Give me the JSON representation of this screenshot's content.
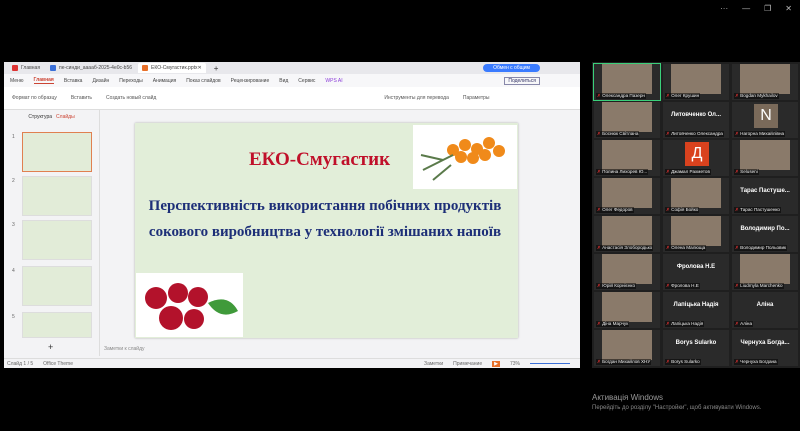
{
  "app": {
    "tabs": [
      {
        "label": "Главная",
        "color": "#d33"
      },
      {
        "label": "пе-синди_ааааб-2025-4e0c-b56",
        "color": "#3a6fd8"
      },
      {
        "label": "ЕКО-Смугастик.pptx",
        "color": "#e8702a"
      }
    ],
    "meet_button": "Обмен с общим",
    "share": "Поделиться"
  },
  "menu": {
    "items": [
      "Меню",
      "Главная",
      "Вставка",
      "Дизайн",
      "Переходы",
      "Анимация",
      "Показ слайдов",
      "Рецензирование",
      "Вид",
      "Сервис",
      "WPS AI"
    ],
    "active": "Главная"
  },
  "ribbon": {
    "items": [
      "Формат по образцу",
      "Вставить",
      "Создать новый слайд",
      "Инструменты для перевода",
      "Параметры"
    ]
  },
  "left_panel": {
    "tabs": [
      "Структура",
      "Слайды"
    ],
    "count": 5
  },
  "slide": {
    "title": "ЕКО-Смугастик",
    "subtitle": "Перспективність використання побічних продуктів сокового виробництва у технології змішаних напоїв"
  },
  "notes": "Заметки к слайду",
  "status": {
    "slide": "Слайд 1 / 5",
    "theme": "Office Theme",
    "notes_btn": "Заметки",
    "comments": "Примечание",
    "zoom": "73%"
  },
  "participants": [
    {
      "name": "Олександра Пазерн",
      "label": "",
      "avatar": "video"
    },
    {
      "name": "Олег Крушин",
      "label": "",
      "avatar": "video"
    },
    {
      "name": "Bogdan Mykhailov",
      "label": "",
      "avatar": "video"
    },
    {
      "name": "Боснюк Світлана",
      "label": "",
      "avatar": "video"
    },
    {
      "name": "Литовченко Олександра",
      "label": "Литовченко Ол...",
      "avatar": "none"
    },
    {
      "name": "Нагорна Михайлівна",
      "label": "",
      "avatar": "N"
    },
    {
      "name": "Полина Лихорев Ю...",
      "label": "",
      "avatar": "video"
    },
    {
      "name": "Джамал Рахметов",
      "label": "",
      "avatar": "Д"
    },
    {
      "name": "Seluseni",
      "label": "",
      "avatar": "video"
    },
    {
      "name": "Олег Федоров",
      "label": "",
      "avatar": "video"
    },
    {
      "name": "Софія Бойко",
      "label": "",
      "avatar": "video"
    },
    {
      "name": "Тарас Пастушенко",
      "label": "Тарас Пастуше...",
      "avatar": "none"
    },
    {
      "name": "Анастасія Злобородько",
      "label": "",
      "avatar": "video"
    },
    {
      "name": "Олена Малюща",
      "label": "",
      "avatar": "video"
    },
    {
      "name": "Володимир Польовик",
      "label": "Володимир По...",
      "avatar": "none"
    },
    {
      "name": "Юрій Корнієнко",
      "label": "",
      "avatar": "video"
    },
    {
      "name": "Фролова Н.Е",
      "label": "Фролова Н.Е",
      "avatar": "none"
    },
    {
      "name": "Liudmyla Marchenko",
      "label": "",
      "avatar": "video"
    },
    {
      "name": "Діна Марчук",
      "label": "",
      "avatar": "video"
    },
    {
      "name": "Лапіцька Надія",
      "label": "Лапіцька Надія",
      "avatar": "none"
    },
    {
      "name": "Аліна",
      "label": "Аліна",
      "avatar": "none"
    },
    {
      "name": "Богдан Михайлов ХНУ",
      "label": "",
      "avatar": "video"
    },
    {
      "name": "Borys Sularko",
      "label": "Borys Sularko",
      "avatar": "none"
    },
    {
      "name": "Чернуха Богдана",
      "label": "Чернуха Богда...",
      "avatar": "none"
    }
  ],
  "windows": {
    "activate": "Активація Windows",
    "hint": "Перейдіть до розділу \"Настройки\", щоб активувати Windows."
  },
  "colors": {
    "title": "#c0102a",
    "subtitle": "#1d2f78",
    "slide_bg": "#e2eed9",
    "active_speaker": "#3ad07a"
  }
}
